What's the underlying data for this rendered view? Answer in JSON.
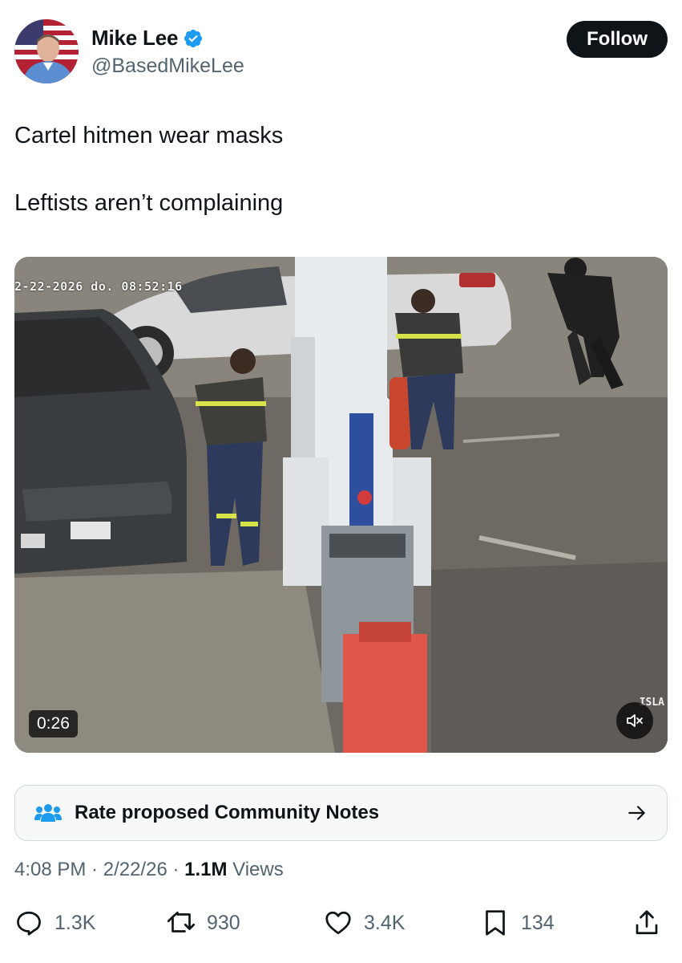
{
  "author": {
    "display_name": "Mike Lee",
    "handle": "@BasedMikeLee",
    "verified": true,
    "avatar_icon": "profile-photo-flag-background"
  },
  "follow_label": "Follow",
  "tweet": {
    "text": "Cartel hitmen wear masks\n\nLeftists aren’t complaining"
  },
  "media": {
    "camera_timestamp": "2-22-2026 do.  08:52:16",
    "duration": "0:26",
    "corner_label": "ISLA",
    "mute_icon": "speaker-muted-icon"
  },
  "community_notes": {
    "label": "Rate proposed Community Notes",
    "icon": "people-icon",
    "arrow_icon": "arrow-right-icon"
  },
  "meta": {
    "time": "4:08 PM",
    "separator": " · ",
    "date": "2/22/26",
    "views_count": "1.1M",
    "views_label": " Views"
  },
  "actions": {
    "replies": "1.3K",
    "reposts": "930",
    "likes": "3.4K",
    "bookmarks": "134"
  },
  "colors": {
    "text_primary": "#0f1419",
    "text_secondary": "#536471",
    "verified_blue": "#1d9bf0",
    "follow_bg": "#0f1419"
  }
}
